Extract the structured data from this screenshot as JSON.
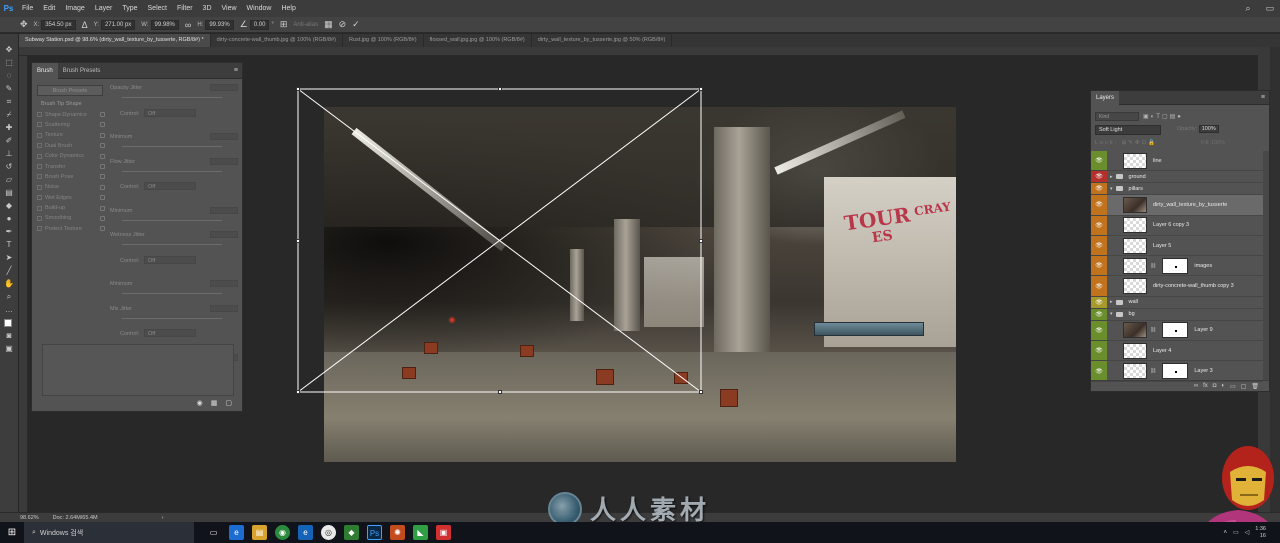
{
  "app": {
    "logo": "Ps"
  },
  "menu": [
    "File",
    "Edit",
    "Image",
    "Layer",
    "Type",
    "Select",
    "Filter",
    "3D",
    "View",
    "Window",
    "Help"
  ],
  "options": {
    "x_label": "X:",
    "x_value": "354.50 px",
    "y_label": "Y:",
    "y_value": "271.00 px",
    "w_label": "W:",
    "w_value": "99.98%",
    "h_label": "H:",
    "h_value": "99.93%",
    "angle_value": "0.00",
    "angle_unit": "°",
    "antialias": "Anti-alias"
  },
  "tabs": [
    "Subway Station.psd @ 98.6% (dirty_wall_texture_by_tusserte, RGB/8#) *",
    "dirty-concrete-wall_thumb.jpg @ 100% (RGB/8#)",
    "Rust.jpg @ 100% (RGB/8#)",
    "flossed_wall.jpg.jpg @ 100% (RGB/8#)",
    "dirty_wall_texture_by_tusserte.jpg @ 50% (RGB/8#)"
  ],
  "brush_panel": {
    "tabs": [
      "Brush",
      "Brush Presets"
    ],
    "preset_button": "Brush Presets",
    "items": [
      {
        "label": "Brush Tip Shape",
        "header": true
      },
      {
        "label": "Shape Dynamics"
      },
      {
        "label": "Scattering"
      },
      {
        "label": "Texture"
      },
      {
        "label": "Dual Brush"
      },
      {
        "label": "Color Dynamics"
      },
      {
        "label": "Transfer"
      },
      {
        "label": "Brush Pose"
      },
      {
        "label": "Noise"
      },
      {
        "label": "Wet Edges"
      },
      {
        "label": "Build-up"
      },
      {
        "label": "Smoothing"
      },
      {
        "label": "Protect Texture"
      }
    ],
    "rows": [
      {
        "label": "Opacity Jitter"
      },
      {
        "control_label": "Control:",
        "control_value": "Off"
      },
      {
        "label": "Minimum"
      },
      {
        "label": "Flow Jitter"
      },
      {
        "control_label": "Control:",
        "control_value": "Off"
      },
      {
        "label": "Minimum"
      },
      {
        "label": "Wetness Jitter"
      },
      {
        "control_label": "Control:",
        "control_value": "Off"
      },
      {
        "label": "Minimum"
      },
      {
        "label": "Mix Jitter"
      },
      {
        "control_label": "Control:",
        "control_value": "Off"
      },
      {
        "label": "Minimum"
      }
    ]
  },
  "layers_panel": {
    "title": "Layers",
    "kind": "Kind",
    "blend_mode": "Soft Light",
    "opacity_label": "Opacity:",
    "opacity_value": "100%",
    "lock_label": "Lock:",
    "fill_label": "Fill:",
    "fill_value": "100%",
    "layers": [
      {
        "name": "line",
        "color": "green",
        "type": "layer"
      },
      {
        "name": "ground",
        "color": "red",
        "type": "group"
      },
      {
        "name": "pillars",
        "color": "orange",
        "type": "group-open"
      },
      {
        "name": "dirty_wall_texture_by_tusserte",
        "color": "orange",
        "type": "image",
        "selected": true
      },
      {
        "name": "Layer 6 copy 3",
        "color": "orange",
        "type": "layer"
      },
      {
        "name": "Layer 5",
        "color": "orange",
        "type": "layer"
      },
      {
        "name": "images",
        "color": "orange",
        "type": "masked"
      },
      {
        "name": "dirty-concrete-wall_thumb copy 3",
        "color": "orange",
        "type": "layer"
      },
      {
        "name": "wall",
        "color": "yellow",
        "type": "group"
      },
      {
        "name": "bg",
        "color": "green",
        "type": "group-open"
      },
      {
        "name": "Layer 9",
        "color": "green",
        "type": "masked-image"
      },
      {
        "name": "Layer 4",
        "color": "green",
        "type": "layer"
      },
      {
        "name": "Layer 3",
        "color": "green",
        "type": "masked"
      }
    ]
  },
  "document": {
    "graffiti": [
      "TOUR",
      "ES",
      "CRAY"
    ]
  },
  "status": {
    "zoom": "98.62%",
    "doc": "Doc: 2.64M/65.4M"
  },
  "taskbar": {
    "search": "Windows 검색",
    "time": "1:36",
    "date": "16"
  },
  "watermark": "人人素材"
}
